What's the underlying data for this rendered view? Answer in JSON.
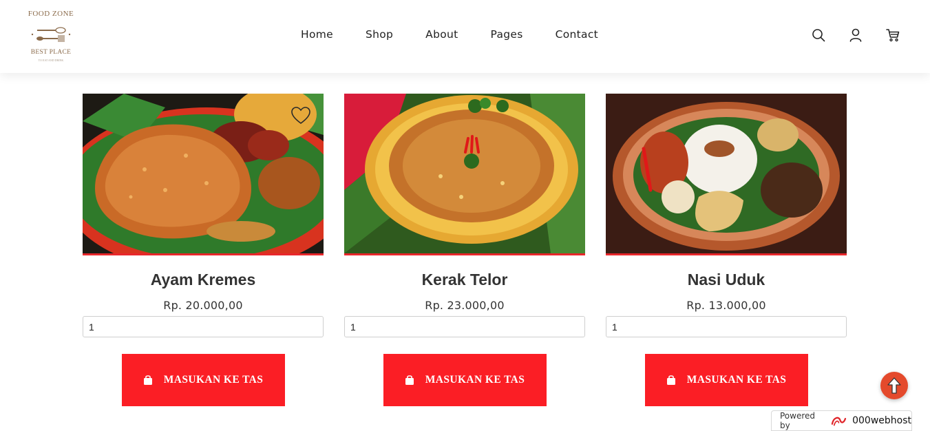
{
  "logo": {
    "top_text": "FOOD ZONE",
    "mid_text": "BEST PLACE",
    "small_text": "TO EAT AND DRINK"
  },
  "nav": {
    "items": [
      "Home",
      "Shop",
      "About",
      "Pages",
      "Contact"
    ]
  },
  "header_icons": [
    "search-icon",
    "account-icon",
    "cart-icon"
  ],
  "products": [
    {
      "name": "Ayam Kremes",
      "price": "Rp. 20.000,00",
      "qty": "1",
      "button": "MASUKAN KE TAS"
    },
    {
      "name": "Kerak Telor",
      "price": "Rp. 23.000,00",
      "qty": "1",
      "button": "MASUKAN KE TAS"
    },
    {
      "name": "Nasi Uduk",
      "price": "Rp. 13.000,00",
      "qty": "1",
      "button": "MASUKAN KE TAS"
    }
  ],
  "powered": {
    "label": "Powered by",
    "brand": "000webhost"
  },
  "colors": {
    "accent_red": "#fb1e25",
    "scroll_top": "#e44a2c",
    "logo_brown": "#8a6a4a"
  }
}
